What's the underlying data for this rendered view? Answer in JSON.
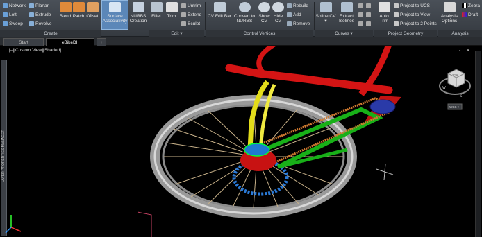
{
  "ribbon": {
    "create": {
      "network": "Network",
      "planar": "Planar",
      "loft": "Loft",
      "extrude": "Extrude",
      "sweep": "Sweep",
      "revolve": "Revolve",
      "blend": "Blend",
      "patch": "Patch",
      "offset": "Offset",
      "label": "Create"
    },
    "surface_assoc": [
      "Surface",
      "Associativity"
    ],
    "nurbs_creation": [
      "NURBS",
      "Creation"
    ],
    "edit": {
      "fillet": "Fillet",
      "trim": "Trim",
      "untrim": "Untrim",
      "extend": "Extend",
      "sculpt": "Sculpt",
      "label": "Edit ▾"
    },
    "control_vertices": {
      "cv_edit_bar": "CV Edit Bar",
      "convert": [
        "Convert to",
        "NURBS"
      ],
      "show_cv": [
        "Show",
        "CV"
      ],
      "hide_cv": [
        "Hide",
        "CV"
      ],
      "rebuild": "Rebuild",
      "add": "Add",
      "remove": "Remove",
      "label": "Control Vertices"
    },
    "curves": {
      "spline_cv": [
        "Spline CV",
        "▾"
      ],
      "extract": [
        "Extract",
        "Isolines"
      ],
      "label": "Curves ▾"
    },
    "project": {
      "auto_trim": [
        "Auto",
        "Trim"
      ],
      "ucs": "Project to UCS",
      "view": "Project to View",
      "two_points": "Project to 2 Points",
      "label": "Project Geometry"
    },
    "analysis": {
      "options": [
        "Analysis",
        "Options"
      ],
      "zebra": "Zebra",
      "draft": "Draft",
      "label": "Analysis"
    }
  },
  "tabs": {
    "start": "Start",
    "current": "eBikeDII",
    "add": "+"
  },
  "viewport": {
    "label": "[–][Custom View][Shaded]",
    "window_controls": "– ▫ ✕",
    "sidebar_title": "LAYER PROPERTIES MANAGER",
    "viewcube_top": "TOP",
    "viewcube_w": "W",
    "viewcube_s": "S",
    "viewcube_ucs": "WCS ▾"
  },
  "colors": {
    "frame": "#e01818",
    "fork": "#e8e020",
    "chainstay": "#18b818",
    "chain": "#d07a30",
    "hub": "#d01818",
    "rotor": "#2a7ad8",
    "tire": "#b8b8b8"
  }
}
